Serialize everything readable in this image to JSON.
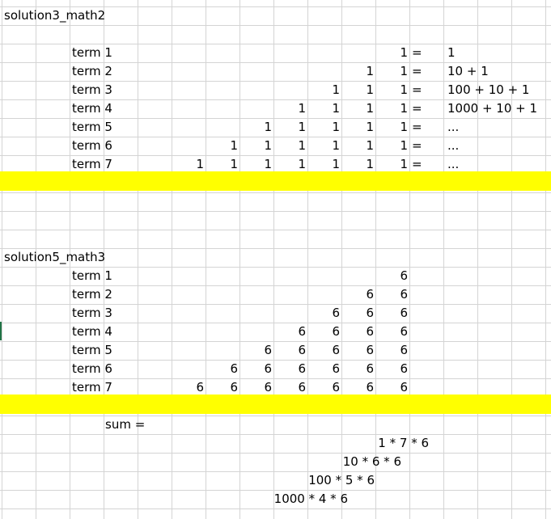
{
  "section1": {
    "title": "solution3_math2",
    "rows": [
      {
        "label": "term 1",
        "ones": [
          "1"
        ],
        "eq": "=",
        "expr": "1"
      },
      {
        "label": "term 2",
        "ones": [
          "1",
          "1"
        ],
        "eq": "=",
        "expr": "10 + 1"
      },
      {
        "label": "term 3",
        "ones": [
          "1",
          "1",
          "1"
        ],
        "eq": "=",
        "expr": "100 + 10 + 1"
      },
      {
        "label": "term 4",
        "ones": [
          "1",
          "1",
          "1",
          "1"
        ],
        "eq": "=",
        "expr": "1000 + 10 + 1"
      },
      {
        "label": "term 5",
        "ones": [
          "1",
          "1",
          "1",
          "1",
          "1"
        ],
        "eq": "=",
        "expr": "..."
      },
      {
        "label": "term 6",
        "ones": [
          "1",
          "1",
          "1",
          "1",
          "1",
          "1"
        ],
        "eq": "=",
        "expr": "..."
      },
      {
        "label": "term 7",
        "ones": [
          "1",
          "1",
          "1",
          "1",
          "1",
          "1",
          "1"
        ],
        "eq": "=",
        "expr": "..."
      }
    ]
  },
  "section2": {
    "title": "solution5_math3",
    "rows": [
      {
        "label": "term 1",
        "sixes": [
          "6"
        ]
      },
      {
        "label": "term 2",
        "sixes": [
          "6",
          "6"
        ]
      },
      {
        "label": "term 3",
        "sixes": [
          "6",
          "6",
          "6"
        ]
      },
      {
        "label": "term 4",
        "sixes": [
          "6",
          "6",
          "6",
          "6"
        ]
      },
      {
        "label": "term 5",
        "sixes": [
          "6",
          "6",
          "6",
          "6",
          "6"
        ]
      },
      {
        "label": "term 6",
        "sixes": [
          "6",
          "6",
          "6",
          "6",
          "6",
          "6"
        ]
      },
      {
        "label": "term 7",
        "sixes": [
          "6",
          "6",
          "6",
          "6",
          "6",
          "6",
          "6"
        ]
      }
    ],
    "sum_label": "sum =",
    "products": [
      "1 * 7 * 6",
      "10 * 6 * 6",
      "100 * 5 * 6",
      "1000 * 4 * 6"
    ]
  },
  "colors": {
    "highlight": "#ffff00",
    "gridline": "#d4d4d4",
    "selection": "#217346"
  }
}
